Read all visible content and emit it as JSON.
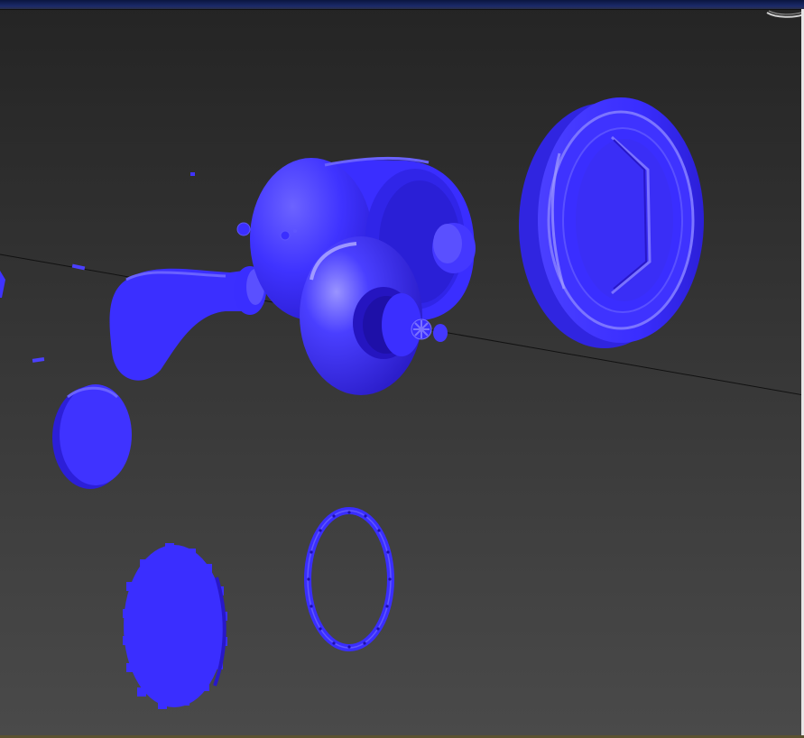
{
  "app": {
    "kind": "3d-viewport",
    "view": "perspective"
  },
  "viewport": {
    "background_top": "#262626",
    "background_bottom": "#484848",
    "object_color": "#3f33ff",
    "object_shadow": "#2415b8",
    "object_highlight": "#8a84ff",
    "axis_line_color": "#111111"
  },
  "scene_objects": [
    {
      "name": "reel-body"
    },
    {
      "name": "reel-handle-knob"
    },
    {
      "name": "spool-housing"
    },
    {
      "name": "drag-star"
    },
    {
      "name": "side-cover-plate"
    },
    {
      "name": "end-cap-disc"
    },
    {
      "name": "gear-disc"
    },
    {
      "name": "bolt-ring"
    },
    {
      "name": "small-screw"
    }
  ],
  "icons": {
    "viewcube": "viewcube-icon"
  }
}
